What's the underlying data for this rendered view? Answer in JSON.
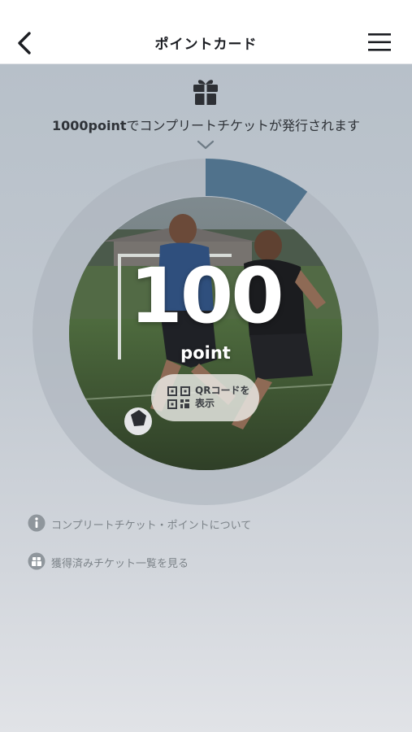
{
  "header": {
    "title": "ポイントカード",
    "back_icon": "chevron-left-icon",
    "menu_icon": "hamburger-menu-icon"
  },
  "info": {
    "gift_icon": "gift-icon",
    "message_bold": "1000point",
    "message_rest": "でコンプリートチケットが発行されます",
    "chevron_icon": "chevron-down-icon"
  },
  "points": {
    "value": "100",
    "unit": "point",
    "goal": 1000,
    "progress_fraction": 0.1
  },
  "qr_button": {
    "icon": "qr-code-icon",
    "label_line1": "QRコードを",
    "label_line2": "表示"
  },
  "links": [
    {
      "icon": "info-icon",
      "label": "コンプリートチケット・ポイントについて"
    },
    {
      "icon": "ticket-icon",
      "label": "獲得済みチケット一覧を見る"
    }
  ],
  "colors": {
    "progress": "#50728c",
    "track": "#a9b1b9",
    "background_top": "#b7c0c9",
    "background_bottom": "#e1e3e7"
  }
}
